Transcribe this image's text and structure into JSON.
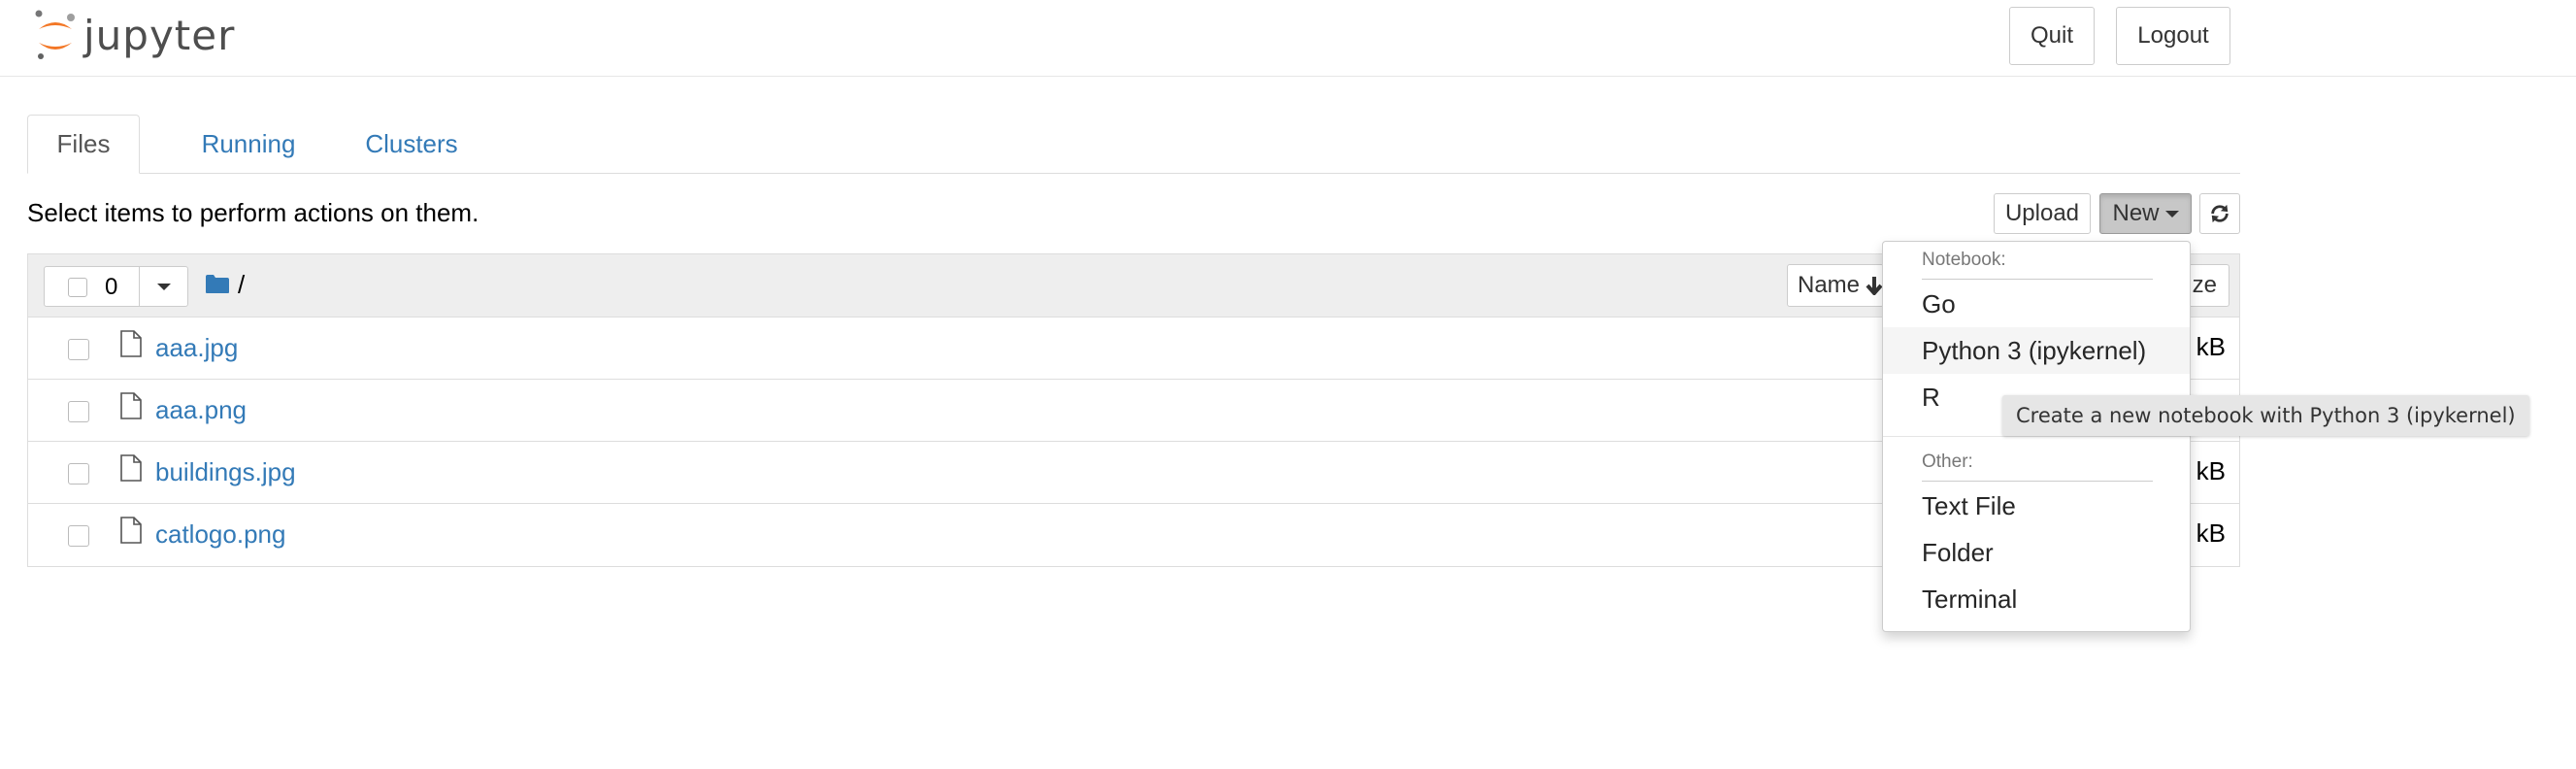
{
  "header": {
    "logo_text": "jupyter",
    "quit_label": "Quit",
    "logout_label": "Logout"
  },
  "tabs": [
    {
      "label": "Files",
      "active": true
    },
    {
      "label": "Running",
      "active": false
    },
    {
      "label": "Clusters",
      "active": false
    }
  ],
  "toolbar": {
    "select_message": "Select items to perform actions on them.",
    "upload_label": "Upload",
    "new_label": "New"
  },
  "list_header": {
    "selected_count": "0",
    "breadcrumb": "/",
    "sort_name_label": "Name",
    "sort_size_label": "ze"
  },
  "files": [
    {
      "name": "aaa.jpg",
      "size": "kB"
    },
    {
      "name": "aaa.png",
      "size": ""
    },
    {
      "name": "buildings.jpg",
      "size": "kB"
    },
    {
      "name": "catlogo.png",
      "size": "kB"
    }
  ],
  "new_menu": {
    "notebook_header": "Notebook:",
    "notebook_items": [
      "Go",
      "Python 3 (ipykernel)",
      "R"
    ],
    "other_header": "Other:",
    "other_items": [
      "Text File",
      "Folder",
      "Terminal"
    ]
  },
  "tooltip": "Create a new notebook with Python 3 (ipykernel)",
  "colors": {
    "link": "#337ab7",
    "logo_orange": "#f37726"
  }
}
